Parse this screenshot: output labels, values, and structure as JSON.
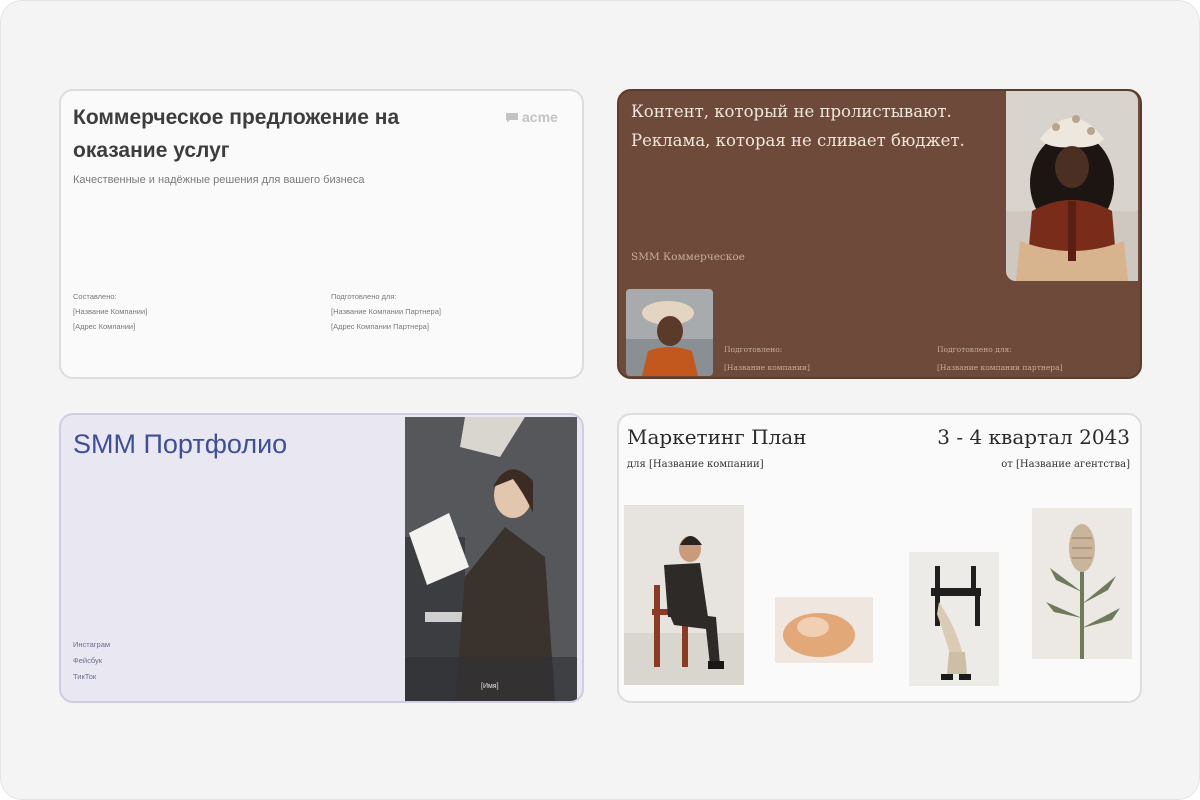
{
  "templates": {
    "proposal": {
      "title": "Коммерческое предложение на оказание услуг",
      "subtitle": "Качественные и надёжные решения для вашего бизнеса",
      "logo": "acme",
      "composed_label": "Составлено:",
      "company_name": "[Название Компании]",
      "company_address": "[Адрес Компании]",
      "prepared_for_label": "Подготовлено для:",
      "partner_name": "[Название Компании Партнера]",
      "partner_address": "[Адрес Компании Партнера]"
    },
    "smm_offer": {
      "headline_line1": "Контент, который не пролистывают.",
      "headline_line2": "Реклама, которая не сливает бюджет.",
      "tag": "SMM  Коммерческое",
      "prepared_label": "Подготовлено:",
      "company_name": "[Название  компании]",
      "prepared_for_label": "Подготовлено  для:",
      "partner_name": "[Название  компании  партнера]"
    },
    "smm_portfolio": {
      "title": "SMM Портфолио",
      "links": [
        "Инстаграм",
        "Фейсбук",
        "ТикТок"
      ],
      "name_placeholder": "[Имя]"
    },
    "marketing_plan": {
      "title": "Маркетинг План",
      "period": "3 - 4 квартал 2043",
      "for_company": "для [Название компании]",
      "from_agency": "от [Название агентства]"
    }
  },
  "colors": {
    "canvas_bg": "#f4f4f4",
    "proposal_bg": "#fafafa",
    "smm_offer_bg": "#6d4a39",
    "portfolio_bg": "#e8e7f2",
    "portfolio_title": "#3e4f96"
  }
}
